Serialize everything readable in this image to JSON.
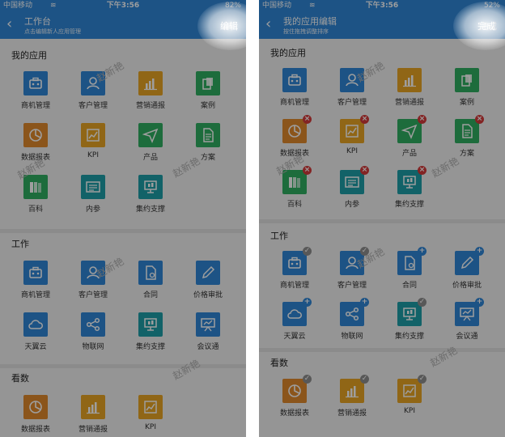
{
  "colors": {
    "header": "#2f86d7",
    "blue": "#2f86d7",
    "orange": "#e0892c",
    "yellow": "#e9a524",
    "green": "#2fae61",
    "teal": "#1e9ea8",
    "remove_badge": "#d33a3a",
    "check_badge": "#8f8f8f"
  },
  "watermark": "赵新艳",
  "left": {
    "status": {
      "carrier": "中国移动",
      "wifi": "wifi-icon",
      "time": "下午3:56",
      "battery": "82%"
    },
    "header": {
      "title": "工作台",
      "subtitle": "点击编辑新人应用管理",
      "action": "编辑"
    },
    "sections": [
      {
        "title": "我的应用",
        "apps": [
          {
            "label": "商机管理",
            "icon": "briefcase-icon",
            "color": "#2f86d7"
          },
          {
            "label": "客户管理",
            "icon": "customer-icon",
            "color": "#2f86d7"
          },
          {
            "label": "营销通报",
            "icon": "bar-chart-icon",
            "color": "#e9a524"
          },
          {
            "label": "案例",
            "icon": "case-icon",
            "color": "#2fae61"
          },
          {
            "label": "数据报表",
            "icon": "pie-chart-icon",
            "color": "#e0892c"
          },
          {
            "label": "KPI",
            "icon": "kpi-icon",
            "color": "#e9a524"
          },
          {
            "label": "产品",
            "icon": "send-icon",
            "color": "#2fae61"
          },
          {
            "label": "方案",
            "icon": "document-icon",
            "color": "#2fae61"
          },
          {
            "label": "百科",
            "icon": "books-icon",
            "color": "#2fae61"
          },
          {
            "label": "内参",
            "icon": "newspaper-icon",
            "color": "#1e9ea8"
          },
          {
            "label": "集约支撑",
            "icon": "support-icon",
            "color": "#1e9ea8"
          }
        ]
      },
      {
        "title": "工作",
        "apps": [
          {
            "label": "商机管理",
            "icon": "briefcase-icon",
            "color": "#2f86d7"
          },
          {
            "label": "客户管理",
            "icon": "customer-icon",
            "color": "#2f86d7"
          },
          {
            "label": "合同",
            "icon": "contract-icon",
            "color": "#2f86d7"
          },
          {
            "label": "价格审批",
            "icon": "pen-icon",
            "color": "#2f86d7"
          },
          {
            "label": "天翼云",
            "icon": "cloud-icon",
            "color": "#2f86d7"
          },
          {
            "label": "物联网",
            "icon": "share-icon",
            "color": "#2f86d7"
          },
          {
            "label": "集约支撑",
            "icon": "support-icon",
            "color": "#1e9ea8"
          },
          {
            "label": "会议通",
            "icon": "presentation-icon",
            "color": "#2f86d7"
          }
        ]
      },
      {
        "title": "看数",
        "apps": [
          {
            "label": "数据报表",
            "icon": "pie-chart-icon",
            "color": "#e0892c"
          },
          {
            "label": "营销通报",
            "icon": "bar-chart-icon",
            "color": "#e9a524"
          },
          {
            "label": "KPI",
            "icon": "kpi-icon",
            "color": "#e9a524"
          }
        ]
      }
    ]
  },
  "right": {
    "status": {
      "carrier": "中国移动",
      "wifi": "wifi-icon",
      "time": "下午3:56",
      "battery": "52%"
    },
    "header": {
      "title": "我的应用编辑",
      "subtitle": "按住拖拽调整排序",
      "action": "完成"
    },
    "sections": [
      {
        "title": "我的应用",
        "apps": [
          {
            "label": "商机管理",
            "icon": "briefcase-icon",
            "color": "#2f86d7",
            "badge": ""
          },
          {
            "label": "客户管理",
            "icon": "customer-icon",
            "color": "#2f86d7",
            "badge": ""
          },
          {
            "label": "营销通报",
            "icon": "bar-chart-icon",
            "color": "#e9a524",
            "badge": ""
          },
          {
            "label": "案例",
            "icon": "case-icon",
            "color": "#2fae61",
            "badge": ""
          },
          {
            "label": "数据报表",
            "icon": "pie-chart-icon",
            "color": "#e0892c",
            "badge": "remove"
          },
          {
            "label": "KPI",
            "icon": "kpi-icon",
            "color": "#e9a524",
            "badge": "remove"
          },
          {
            "label": "产品",
            "icon": "send-icon",
            "color": "#2fae61",
            "badge": "remove"
          },
          {
            "label": "方案",
            "icon": "document-icon",
            "color": "#2fae61",
            "badge": "remove"
          },
          {
            "label": "百科",
            "icon": "books-icon",
            "color": "#2fae61",
            "badge": "remove"
          },
          {
            "label": "内参",
            "icon": "newspaper-icon",
            "color": "#1e9ea8",
            "badge": "remove"
          },
          {
            "label": "集约支撑",
            "icon": "support-icon",
            "color": "#1e9ea8",
            "badge": "remove"
          }
        ]
      },
      {
        "title": "工作",
        "apps": [
          {
            "label": "商机管理",
            "icon": "briefcase-icon",
            "color": "#2f86d7",
            "badge": "check"
          },
          {
            "label": "客户管理",
            "icon": "customer-icon",
            "color": "#2f86d7",
            "badge": "check"
          },
          {
            "label": "合同",
            "icon": "contract-icon",
            "color": "#2f86d7",
            "badge": "add"
          },
          {
            "label": "价格审批",
            "icon": "pen-icon",
            "color": "#2f86d7",
            "badge": "add"
          },
          {
            "label": "天翼云",
            "icon": "cloud-icon",
            "color": "#2f86d7",
            "badge": "add"
          },
          {
            "label": "物联网",
            "icon": "share-icon",
            "color": "#2f86d7",
            "badge": "add"
          },
          {
            "label": "集约支撑",
            "icon": "support-icon",
            "color": "#1e9ea8",
            "badge": "check"
          },
          {
            "label": "会议通",
            "icon": "presentation-icon",
            "color": "#2f86d7",
            "badge": "add"
          }
        ]
      },
      {
        "title": "看数",
        "apps": [
          {
            "label": "数据报表",
            "icon": "pie-chart-icon",
            "color": "#e0892c",
            "badge": "check"
          },
          {
            "label": "营销通报",
            "icon": "bar-chart-icon",
            "color": "#e9a524",
            "badge": "check"
          },
          {
            "label": "KPI",
            "icon": "kpi-icon",
            "color": "#e9a524",
            "badge": "check"
          }
        ]
      }
    ]
  }
}
